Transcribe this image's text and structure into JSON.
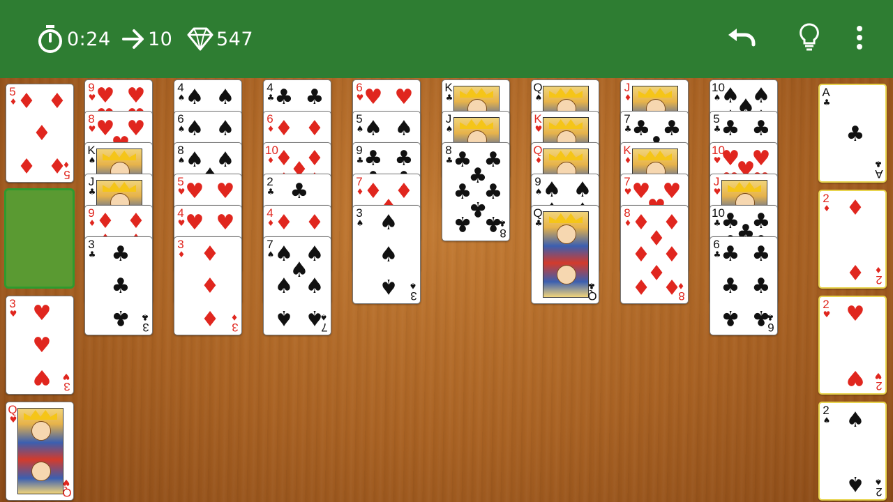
{
  "header": {
    "time": "0:24",
    "moves": "10",
    "score": "547",
    "icons": {
      "timer": "stopwatch-icon",
      "moves": "arrow-right-icon",
      "score": "diamond-icon",
      "undo": "undo-icon",
      "hint": "lightbulb-icon",
      "menu": "more-vert-icon"
    }
  },
  "colors": {
    "bar": "#2e7d32",
    "red_suit": "#e0261e",
    "black_suit": "#111111",
    "felt_empty": "#5a9a32"
  },
  "free_cells": [
    "5♦",
    "",
    "3♥",
    "Q♥"
  ],
  "foundations": [
    "A♣",
    "2♦",
    "2♥",
    "2♠"
  ],
  "tableau": [
    [
      "9♥",
      "8♥",
      "K♠",
      "J♣",
      "9♦",
      "3♣"
    ],
    [
      "4♠",
      "6♠",
      "8♠",
      "5♥",
      "4♥",
      "3♦"
    ],
    [
      "4♣",
      "6♦",
      "10♦",
      "2♣",
      "4♦",
      "7♠"
    ],
    [
      "6♥",
      "5♠",
      "9♣",
      "7♦",
      "3♠"
    ],
    [
      "K♣",
      "J♠",
      "8♣"
    ],
    [
      "Q♠",
      "K♥",
      "Q♦",
      "9♠",
      "Q♣"
    ],
    [
      "J♦",
      "7♣",
      "K♦",
      "7♥",
      "8♦"
    ],
    [
      "10♠",
      "5♣",
      "10♥",
      "J♥",
      "10♣",
      "6♣"
    ]
  ]
}
